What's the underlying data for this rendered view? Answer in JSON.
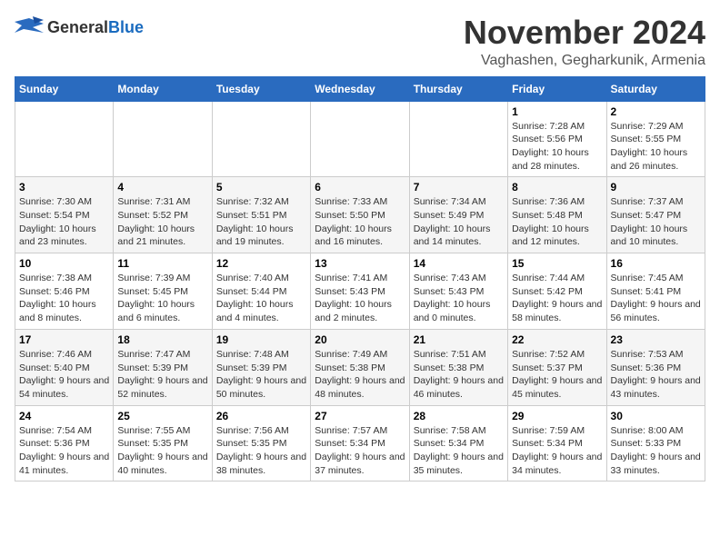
{
  "logo": {
    "general": "General",
    "blue": "Blue"
  },
  "title": "November 2024",
  "location": "Vaghashen, Gegharkunik, Armenia",
  "weekdays": [
    "Sunday",
    "Monday",
    "Tuesday",
    "Wednesday",
    "Thursday",
    "Friday",
    "Saturday"
  ],
  "weeks": [
    [
      {
        "day": "",
        "content": ""
      },
      {
        "day": "",
        "content": ""
      },
      {
        "day": "",
        "content": ""
      },
      {
        "day": "",
        "content": ""
      },
      {
        "day": "",
        "content": ""
      },
      {
        "day": "1",
        "content": "Sunrise: 7:28 AM\nSunset: 5:56 PM\nDaylight: 10 hours and 28 minutes."
      },
      {
        "day": "2",
        "content": "Sunrise: 7:29 AM\nSunset: 5:55 PM\nDaylight: 10 hours and 26 minutes."
      }
    ],
    [
      {
        "day": "3",
        "content": "Sunrise: 7:30 AM\nSunset: 5:54 PM\nDaylight: 10 hours and 23 minutes."
      },
      {
        "day": "4",
        "content": "Sunrise: 7:31 AM\nSunset: 5:52 PM\nDaylight: 10 hours and 21 minutes."
      },
      {
        "day": "5",
        "content": "Sunrise: 7:32 AM\nSunset: 5:51 PM\nDaylight: 10 hours and 19 minutes."
      },
      {
        "day": "6",
        "content": "Sunrise: 7:33 AM\nSunset: 5:50 PM\nDaylight: 10 hours and 16 minutes."
      },
      {
        "day": "7",
        "content": "Sunrise: 7:34 AM\nSunset: 5:49 PM\nDaylight: 10 hours and 14 minutes."
      },
      {
        "day": "8",
        "content": "Sunrise: 7:36 AM\nSunset: 5:48 PM\nDaylight: 10 hours and 12 minutes."
      },
      {
        "day": "9",
        "content": "Sunrise: 7:37 AM\nSunset: 5:47 PM\nDaylight: 10 hours and 10 minutes."
      }
    ],
    [
      {
        "day": "10",
        "content": "Sunrise: 7:38 AM\nSunset: 5:46 PM\nDaylight: 10 hours and 8 minutes."
      },
      {
        "day": "11",
        "content": "Sunrise: 7:39 AM\nSunset: 5:45 PM\nDaylight: 10 hours and 6 minutes."
      },
      {
        "day": "12",
        "content": "Sunrise: 7:40 AM\nSunset: 5:44 PM\nDaylight: 10 hours and 4 minutes."
      },
      {
        "day": "13",
        "content": "Sunrise: 7:41 AM\nSunset: 5:43 PM\nDaylight: 10 hours and 2 minutes."
      },
      {
        "day": "14",
        "content": "Sunrise: 7:43 AM\nSunset: 5:43 PM\nDaylight: 10 hours and 0 minutes."
      },
      {
        "day": "15",
        "content": "Sunrise: 7:44 AM\nSunset: 5:42 PM\nDaylight: 9 hours and 58 minutes."
      },
      {
        "day": "16",
        "content": "Sunrise: 7:45 AM\nSunset: 5:41 PM\nDaylight: 9 hours and 56 minutes."
      }
    ],
    [
      {
        "day": "17",
        "content": "Sunrise: 7:46 AM\nSunset: 5:40 PM\nDaylight: 9 hours and 54 minutes."
      },
      {
        "day": "18",
        "content": "Sunrise: 7:47 AM\nSunset: 5:39 PM\nDaylight: 9 hours and 52 minutes."
      },
      {
        "day": "19",
        "content": "Sunrise: 7:48 AM\nSunset: 5:39 PM\nDaylight: 9 hours and 50 minutes."
      },
      {
        "day": "20",
        "content": "Sunrise: 7:49 AM\nSunset: 5:38 PM\nDaylight: 9 hours and 48 minutes."
      },
      {
        "day": "21",
        "content": "Sunrise: 7:51 AM\nSunset: 5:38 PM\nDaylight: 9 hours and 46 minutes."
      },
      {
        "day": "22",
        "content": "Sunrise: 7:52 AM\nSunset: 5:37 PM\nDaylight: 9 hours and 45 minutes."
      },
      {
        "day": "23",
        "content": "Sunrise: 7:53 AM\nSunset: 5:36 PM\nDaylight: 9 hours and 43 minutes."
      }
    ],
    [
      {
        "day": "24",
        "content": "Sunrise: 7:54 AM\nSunset: 5:36 PM\nDaylight: 9 hours and 41 minutes."
      },
      {
        "day": "25",
        "content": "Sunrise: 7:55 AM\nSunset: 5:35 PM\nDaylight: 9 hours and 40 minutes."
      },
      {
        "day": "26",
        "content": "Sunrise: 7:56 AM\nSunset: 5:35 PM\nDaylight: 9 hours and 38 minutes."
      },
      {
        "day": "27",
        "content": "Sunrise: 7:57 AM\nSunset: 5:34 PM\nDaylight: 9 hours and 37 minutes."
      },
      {
        "day": "28",
        "content": "Sunrise: 7:58 AM\nSunset: 5:34 PM\nDaylight: 9 hours and 35 minutes."
      },
      {
        "day": "29",
        "content": "Sunrise: 7:59 AM\nSunset: 5:34 PM\nDaylight: 9 hours and 34 minutes."
      },
      {
        "day": "30",
        "content": "Sunrise: 8:00 AM\nSunset: 5:33 PM\nDaylight: 9 hours and 33 minutes."
      }
    ]
  ]
}
